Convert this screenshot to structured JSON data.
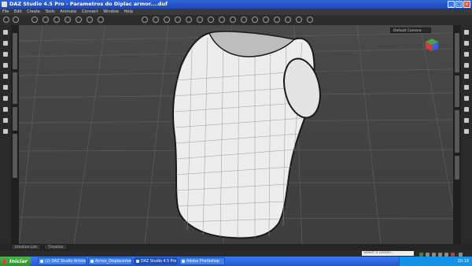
{
  "window": {
    "title": "DAZ Studio 4.5 Pro - Parametros do Diplac armor....duf"
  },
  "menu": [
    "File",
    "Edit",
    "Create",
    "Tools",
    "Animate",
    "Connect",
    "Window",
    "Help"
  ],
  "viewport": {
    "camera": "Default Camera"
  },
  "bottom_tabs": [
    "timeline Lite",
    "Timeline"
  ],
  "status": {
    "lesson_placeholder": "Select a Lesson..."
  },
  "taskbar": {
    "start_label": "Iniciar",
    "items": [
      "(2) DAZ Studio Artists",
      "Armor_Displacement",
      "DAZ Studio 4.5 Pro -...",
      "Adobe Photoshop"
    ],
    "clock": "20:19"
  }
}
